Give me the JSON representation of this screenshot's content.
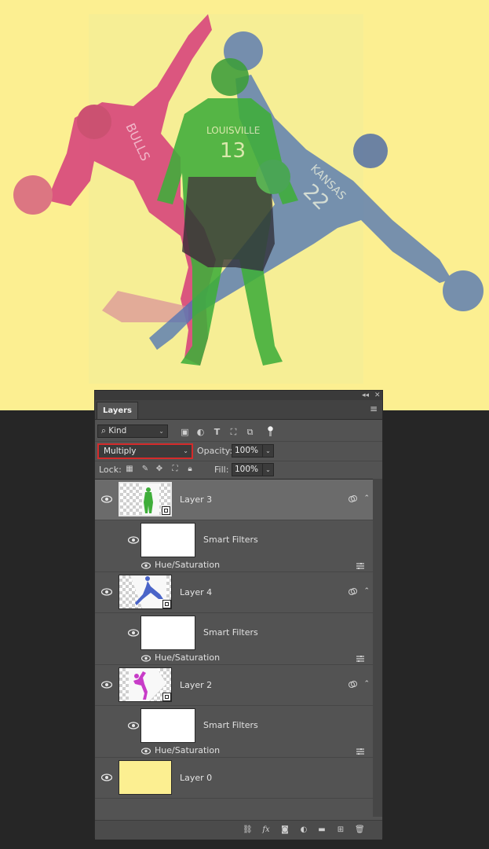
{
  "panel": {
    "tab_title": "Layers",
    "collapse_glyph": "◂◂",
    "close_glyph": "✕",
    "menu_glyph": "≡"
  },
  "filter": {
    "kind_label": "Kind",
    "search_icon": "search-icon",
    "icons": [
      "image-filter-icon",
      "adjustment-filter-icon",
      "type-filter-icon",
      "shape-filter-icon",
      "smart-object-filter-icon"
    ]
  },
  "blend": {
    "mode": "Multiply",
    "opacity_label": "Opacity:",
    "opacity_value": "100%",
    "highlight_color": "#d52b2b"
  },
  "lock": {
    "label": "Lock:",
    "icons": [
      "lock-transparent-pixels-icon",
      "lock-image-pixels-icon",
      "lock-position-icon",
      "lock-artboard-icon",
      "lock-all-icon"
    ],
    "fill_label": "Fill:",
    "fill_value": "100%"
  },
  "layers": [
    {
      "name": "Layer 3",
      "selected": true,
      "figure_color": "#3fae3a",
      "smart_filters_label": "Smart Filters",
      "filter_name": "Hue/Saturation"
    },
    {
      "name": "Layer 4",
      "selected": false,
      "figure_color": "#4a64c8",
      "smart_filters_label": "Smart Filters",
      "filter_name": "Hue/Saturation"
    },
    {
      "name": "Layer 2",
      "selected": false,
      "figure_color": "#c83cc8",
      "smart_filters_label": "Smart Filters",
      "filter_name": "Hue/Saturation"
    },
    {
      "name": "Layer 0",
      "selected": false,
      "fill_color": "#fcef91"
    }
  ],
  "canvas": {
    "background_color": "#fcef91",
    "jersey_texts": [
      "LOUISVILLE",
      "13",
      "BULLS",
      "KANSAS",
      "22"
    ]
  },
  "bottom_icons": [
    "link-layers-icon",
    "fx-icon",
    "add-mask-icon",
    "new-adjustment-icon",
    "new-group-icon",
    "new-layer-icon",
    "delete-layer-icon"
  ],
  "bottom_labels": {
    "fx": "fx"
  }
}
